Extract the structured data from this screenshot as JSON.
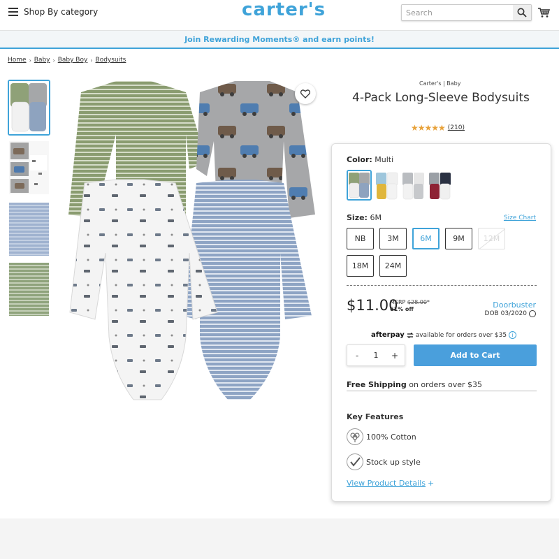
{
  "header": {
    "shop_by_category": "Shop By category",
    "logo": "carter's",
    "search_placeholder": "Search"
  },
  "promo": {
    "text": "Join Rewarding Moments® and earn points!"
  },
  "breadcrumb": [
    "Home",
    "Baby",
    "Baby Boy",
    "Bodysuits"
  ],
  "product": {
    "brand": "Carter's | Baby",
    "title": "4-Pack Long-Sleeve Bodysuits",
    "stars": "★★★★★",
    "rating": 5,
    "review_count": "(210)"
  },
  "color": {
    "label": "Color:",
    "value": "Multi"
  },
  "size": {
    "label": "Size:",
    "value": "6M",
    "chart_link": "Size Chart",
    "options": [
      "NB",
      "3M",
      "6M",
      "9M",
      "12M",
      "18M",
      "24M"
    ],
    "selected": "6M",
    "unavailable": [
      "12M"
    ]
  },
  "pricing": {
    "price": "$11.00",
    "msrp_label": "MSRP",
    "msrp_value": "$28.00",
    "msrp_asterisk": "*",
    "percent_off": "61% off",
    "promo_label": "Doorbuster",
    "dob": "DOB 03/2020"
  },
  "afterpay": {
    "logo": "afterpay",
    "text": "available for orders over $35"
  },
  "quantity": {
    "minus": "-",
    "value": "1",
    "plus": "+"
  },
  "add_to_cart": "Add to Cart",
  "shipping": {
    "bold": "Free Shipping",
    "rest": " on orders over $35"
  },
  "key_features": {
    "title": "Key Features",
    "items": [
      "100% Cotton",
      "Stock up style"
    ]
  },
  "view_details": "View Product Details",
  "view_details_plus": "+",
  "colors": {
    "accent": "#3fa3d9",
    "button": "#4a9fdc",
    "star": "#e8a23a"
  }
}
